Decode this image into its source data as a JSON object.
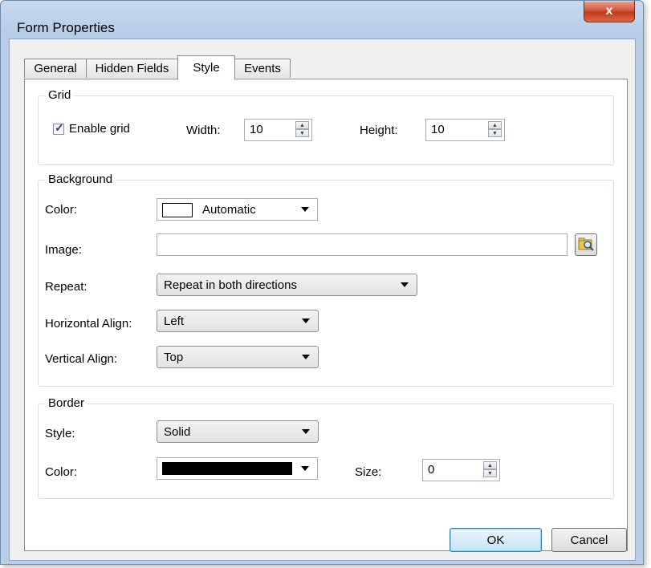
{
  "window": {
    "title": "Form Properties",
    "close_symbol": "x"
  },
  "tabs": [
    {
      "label": "General"
    },
    {
      "label": "Hidden Fields"
    },
    {
      "label": "Style"
    },
    {
      "label": "Events"
    }
  ],
  "grid": {
    "title": "Grid",
    "enable_label": "Enable grid",
    "enabled": true,
    "width_label": "Width:",
    "width_value": "10",
    "height_label": "Height:",
    "height_value": "10"
  },
  "background": {
    "title": "Background",
    "color_label": "Color:",
    "color_value": "Automatic",
    "color_swatch": "#ffffff",
    "image_label": "Image:",
    "image_value": "",
    "repeat_label": "Repeat:",
    "repeat_value": "Repeat in both directions",
    "halign_label": "Horizontal Align:",
    "halign_value": "Left",
    "valign_label": "Vertical Align:",
    "valign_value": "Top"
  },
  "border": {
    "title": "Border",
    "style_label": "Style:",
    "style_value": "Solid",
    "color_label": "Color:",
    "color_swatch": "#000000",
    "size_label": "Size:",
    "size_value": "0"
  },
  "buttons": {
    "ok": "OK",
    "cancel": "Cancel"
  }
}
